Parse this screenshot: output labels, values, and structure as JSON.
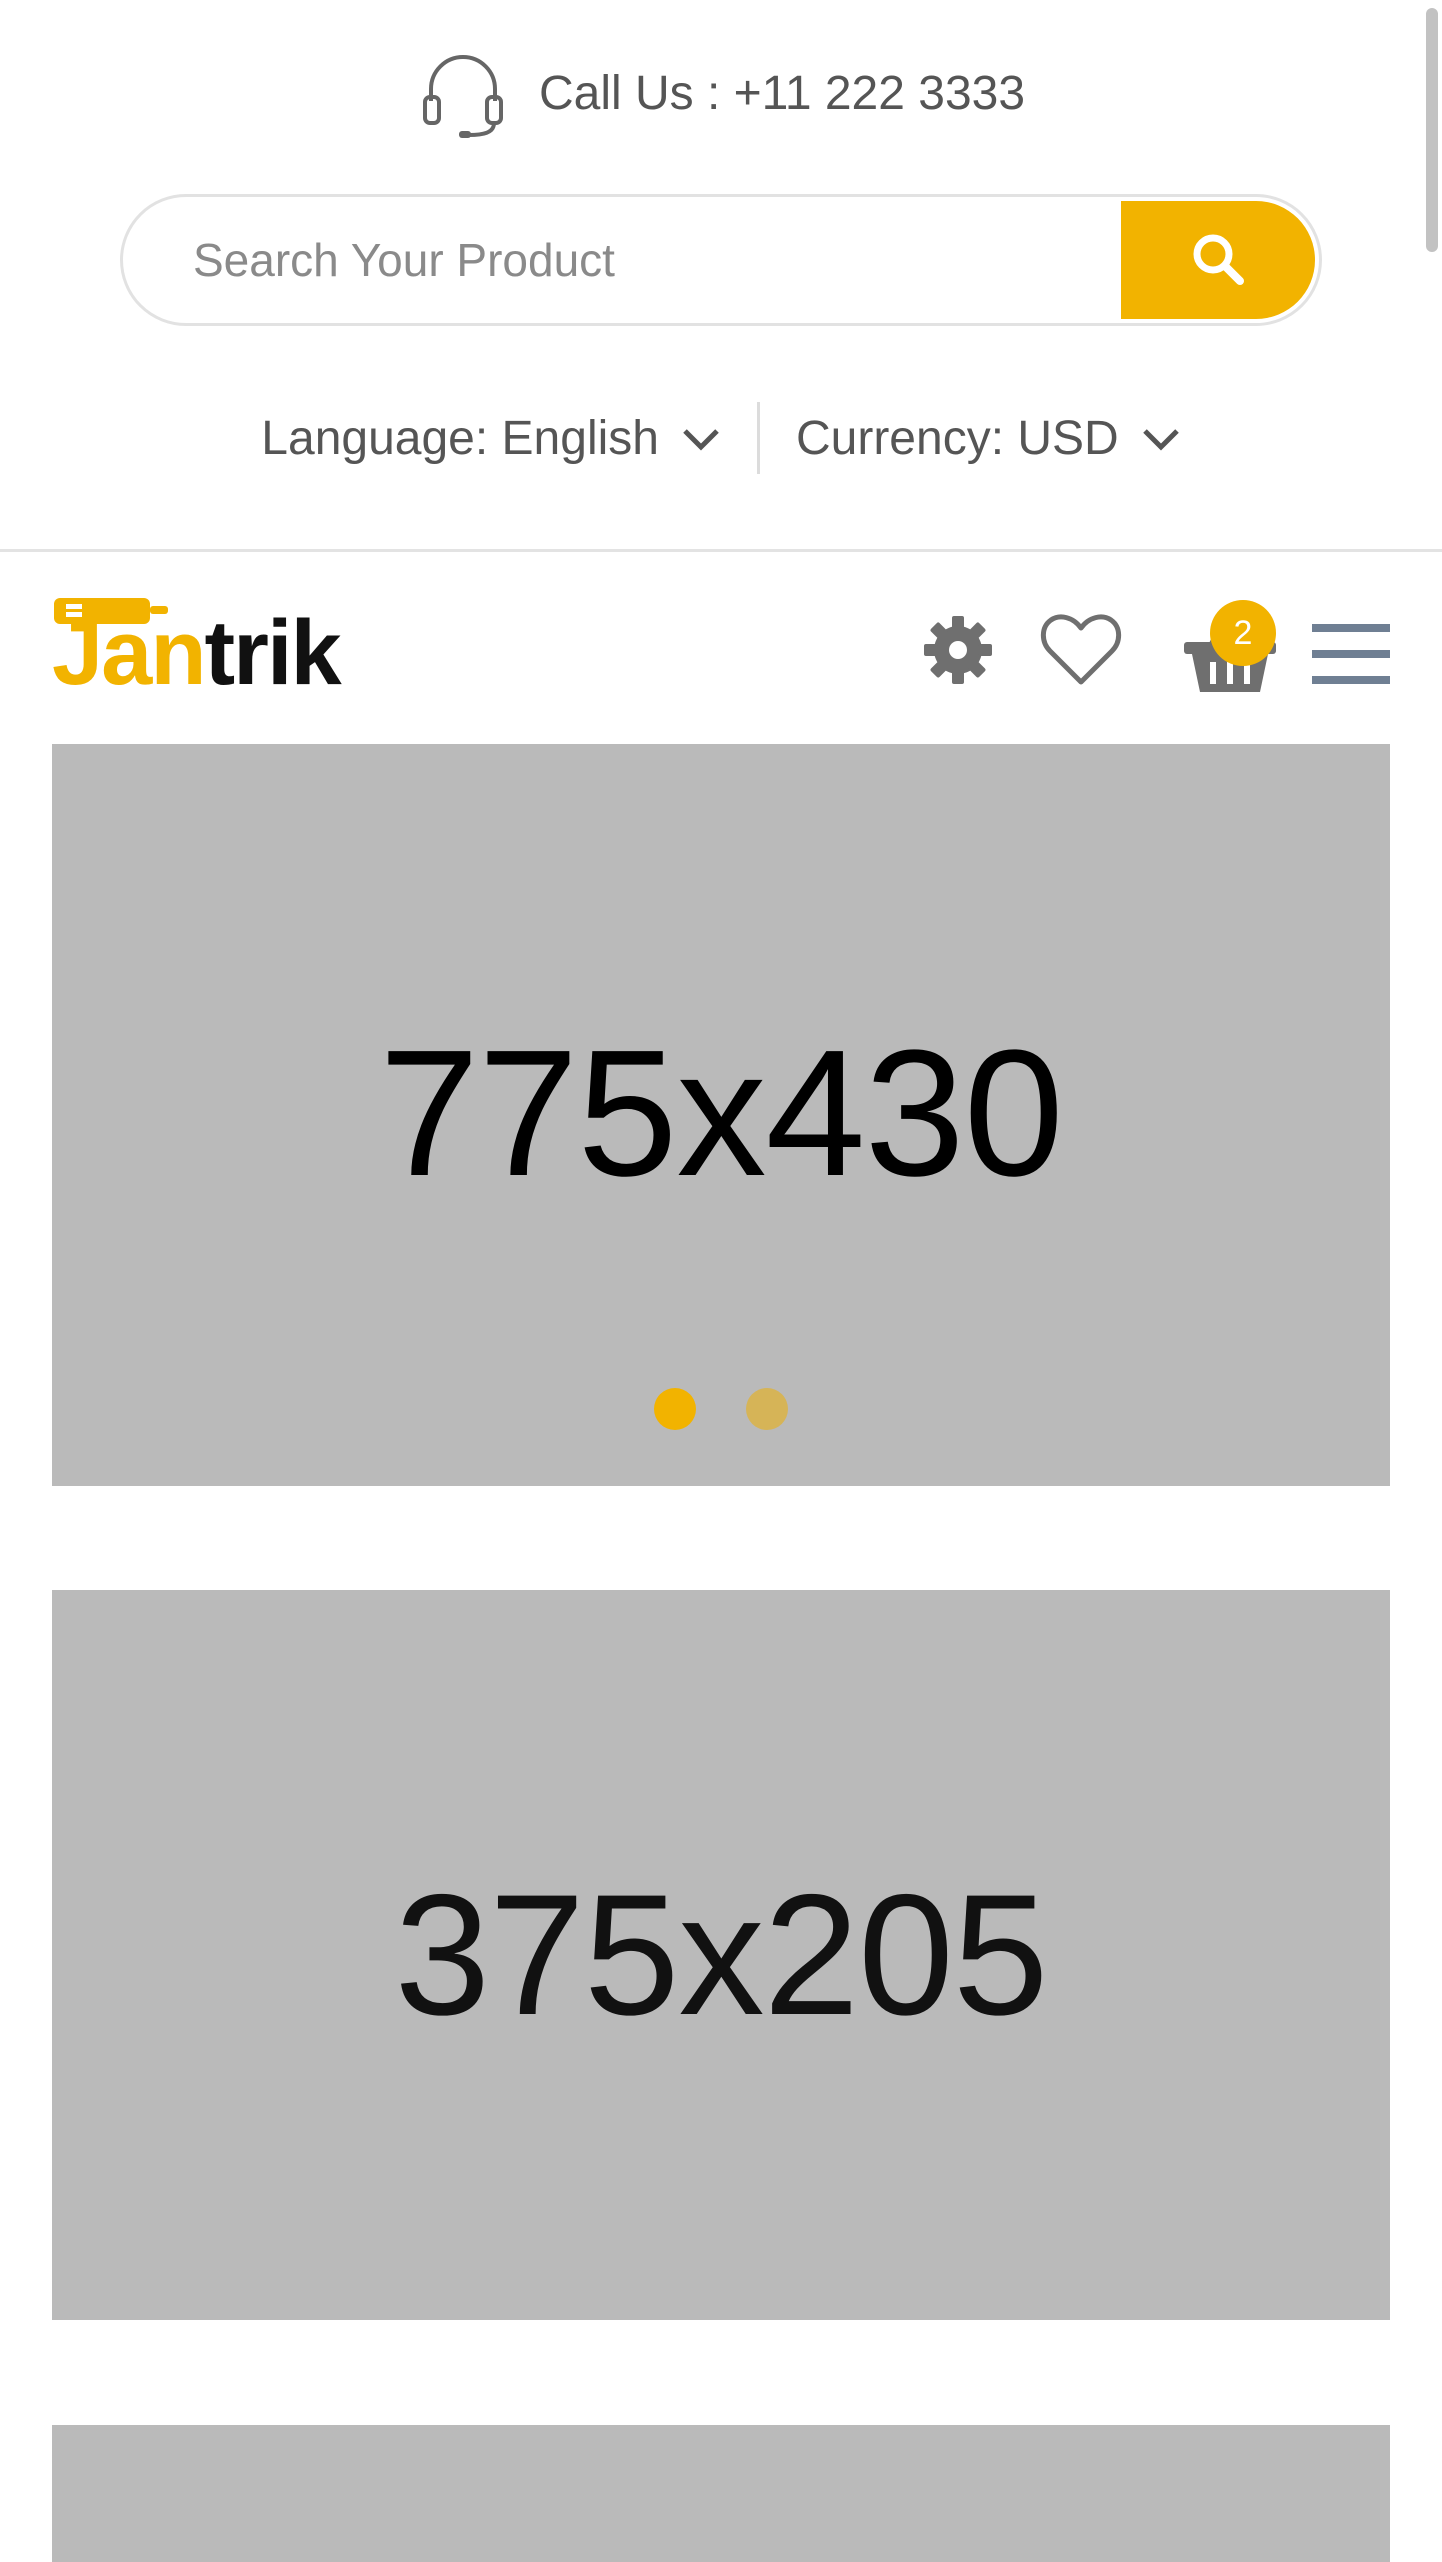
{
  "top_bar": {
    "call_text": "Call Us : +11 222 3333",
    "icon": "headset-icon"
  },
  "search": {
    "placeholder": "Search Your Product",
    "value": "",
    "button_icon": "search-icon"
  },
  "selectors": {
    "language_label": "Language: English",
    "currency_label": "Currency: USD"
  },
  "header": {
    "logo_text_j": "J",
    "logo_text_an": "an",
    "logo_text_trik": "trik",
    "icons": [
      "gear-icon",
      "heart-icon",
      "cart-icon",
      "menu-icon"
    ],
    "cart_count": "2"
  },
  "banners": [
    {
      "label": "775x430",
      "slides": 2,
      "active_slide": 1
    },
    {
      "label": "375x205"
    },
    {
      "label": ""
    }
  ],
  "colors": {
    "accent": "#f2b300",
    "placeholder_bg": "#bababa",
    "text": "#555555"
  }
}
